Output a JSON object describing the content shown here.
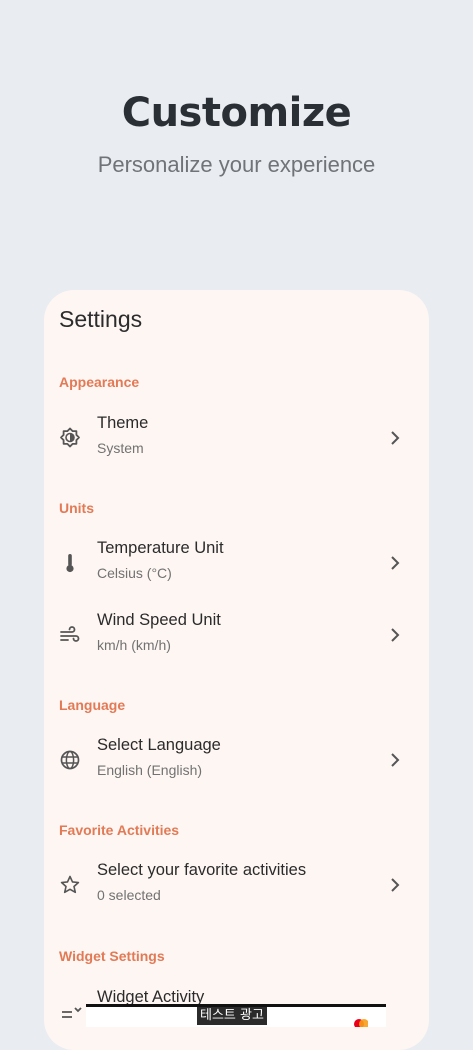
{
  "hero": {
    "title": "Customize",
    "subtitle": "Personalize your experience"
  },
  "settings": {
    "title": "Settings",
    "sections": {
      "appearance": "Appearance",
      "units": "Units",
      "language": "Language",
      "favorites": "Favorite Activities",
      "widget": "Widget Settings"
    },
    "items": {
      "theme": {
        "title": "Theme",
        "value": "System",
        "icon": "brightness-icon"
      },
      "temperature": {
        "title": "Temperature Unit",
        "value": "Celsius (°C)",
        "icon": "thermometer-icon"
      },
      "wind": {
        "title": "Wind Speed Unit",
        "value": "km/h (km/h)",
        "icon": "wind-icon"
      },
      "language": {
        "title": "Select Language",
        "value": "English (English)",
        "icon": "globe-icon"
      },
      "activities": {
        "title": "Select your favorite activities",
        "value": "0 selected",
        "icon": "star-icon"
      },
      "widget_activity": {
        "title": "Widget Activity",
        "icon": "widget-icon"
      }
    }
  },
  "ad": {
    "label": "테스트 광고"
  },
  "colors": {
    "accent": "#e27a55",
    "card": "#fdf6f3",
    "background": "#e9ecf1"
  }
}
